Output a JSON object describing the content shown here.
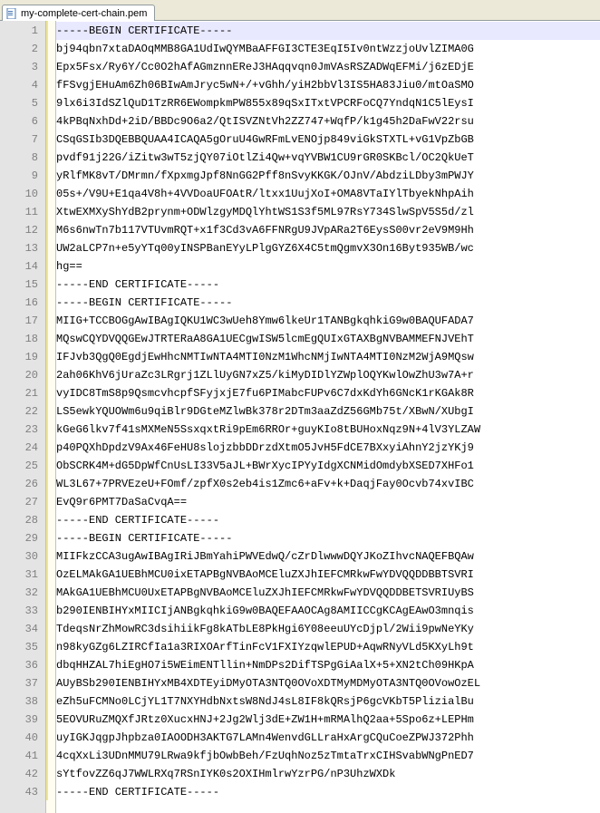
{
  "tab": {
    "filename": "my-complete-cert-chain.pem"
  },
  "lines": [
    "-----BEGIN CERTIFICATE-----",
    "bj94qbn7xtaDAOqMMB8GA1UdIwQYMBaAFFGI3CTE3EqI5Iv0ntWzzjoUvlZIMA0G",
    "Epx5Fsx/Ry6Y/Cc0O2hAfAGmznnEReJ3HAqqvqn0JmVAsRSZADWqEFMi/j6zEDjE",
    "fFSvgjEHuAm6Zh06BIwAmJryc5wN+/+vGhh/yiH2bbVl3IS5HA83Jiu0/mtOaSMO",
    "9lx6i3IdSZlQuD1TzRR6EWompkmPW855x89qSxITxtVPCRFoCQ7YndqN1C5lEysI",
    "4kPBqNxhDd+2iD/BBDc9O6a2/QtISVZNtVh2ZZ747+WqfP/k1g45h2DaFwV22rsu",
    "CSqGSIb3DQEBBQUAA4ICAQA5gOruU4GwRFmLvENOjp849viGkSTXTL+vG1VpZbGB",
    "pvdf91j22G/iZitw3wT5zjQY07iOtlZi4Qw+vqYVBW1CU9rGR0SKBcl/OC2QkUeT",
    "yRlfMK8vT/DMrmn/fXpxmgJpf8NnGG2Pff8nSvyKKGK/OJnV/AbdziLDby3mPWJY",
    "05s+/V9U+E1qa4V8h+4VVDoaUFOAtR/ltxx1UujXoI+OMA8VTaIYlTbyekNhpAih",
    "XtwEXMXyShYdB2prynm+ODWlzgyMDQlYhtWS1S3f5ML97RsY734SlwSpV5S5d/zl",
    "M6s6nwTn7b117VTUvmRQT+x1f3Cd3vA6FFNRgU9JVpARa2T6EysS00vr2eV9M9Hh",
    "UW2aLCP7n+e5yYTq00yINSPBanEYyLPlgGYZ6X4C5tmQgmvX3On16Byt935WB/wc",
    "hg==",
    "-----END CERTIFICATE-----",
    "-----BEGIN CERTIFICATE-----",
    "MIIG+TCCBOGgAwIBAgIQKU1WC3wUeh8Ymw6lkeUr1TANBgkqhkiG9w0BAQUFADA7",
    "MQswCQYDVQQGEwJTRTERaA8GA1UECgwISW5lcmEgQUIxGTAXBgNVBAMMEFNJVEhT",
    "IFJvb3QgQ0EgdjEwHhcNMTIwNTA4MTI0NzM1WhcNMjIwNTA4MTI0NzM2WjA9MQsw",
    "2ah06KhV6jUraZc3LRgrj1ZLlUyGN7xZ5/kiMyDIDlYZWplOQYKwlOwZhU3w7A+r",
    "vyIDC8TmS8p9QsmcvhcpfSFyjxjE7fu6PIMabcFUPv6C7dxKdYh6GNcK1rKGAk8R",
    "LS5ewkYQUOWm6u9qiBlr9DGteMZlwBk378r2DTm3aaZdZ56GMb75t/XBwN/XUbgI",
    "kGeG6lkv7f41sMXMeN5SsxqxtRi9pEm6RROr+guyKIo8tBUHoxNqz9N+4lV3YLZAW",
    "p40PQXhDpdzV9Ax46FeHU8slojzbbDDrzdXtmO5JvH5FdCE7BXxyiAhnY2jzYKj9",
    "ObSCRK4M+dG5DpWfCnUsLI33V5aJL+BWrXycIPYyIdgXCNMidOmdybXSED7XHFo1",
    "WL3L67+7PRVEzeU+FOmf/zpfX0s2eb4is1Zmc6+aFv+k+DaqjFay0Ocvb74xvIBC",
    "EvQ9r6PMT7DaSaCvqA==",
    "-----END CERTIFICATE-----",
    "-----BEGIN CERTIFICATE-----",
    "MIIFkzCCA3ugAwIBAgIRiJBmYahiPWVEdwQ/cZrDlwwwDQYJKoZIhvcNAQEFBQAw",
    "OzELMAkGA1UEBhMCU0ixETAPBgNVBAoMCEluZXJhIEFCMRkwFwYDVQQDDBBTSVRI",
    "MAkGA1UEBhMCU0UxETAPBgNVBAoMCEluZXJhIEFCMRkwFwYDVQQDDBETSVRIUyBS",
    "b290IENBIHYxMIICIjANBgkqhkiG9w0BAQEFAAOCAg8AMIICCgKCAgEAwO3mnqis",
    "TdeqsNrZhMowRC3dsihiikFg8kATbLE8PkHgi6Y08eeuUYcDjpl/2Wii9pwNeYKy",
    "n98kyGZg6LZIRCfIa1a3RIXOArfTinFcV1FXIYzqwlEPUD+AqwRNyVLd5KXyLh9t",
    "dbqHHZAL7hiEgHO7i5WEimENTllin+NmDPs2DifTSPgGiAalX+5+XN2tCh09HKpA",
    "AUyBSb290IENBIHYxMB4XDTEyiDMyOTA3NTQ0OVoXDTMyMDMyOTA3NTQ0OVowOzEL",
    "eZh5uFCMNo0LCjYL1T7NXYHdbNxtsW8NdJ4sL8IF8kQRsjP6gcVKbT5PlizialBu",
    "5EOVURuZMQXfJRtz0XucxHNJ+2Jg2Wlj3dE+ZW1H+mRMAlhQ2aa+5Spo6z+LEPHm",
    "uyIGKJqgpJhpbza0IAOODH3AKTG7LAMn4WenvdGLLraHxArgCQuCoeZPWJ372Phh",
    "4cqXxLi3UDnMMU79LRwa9kfjbOwbBeh/FzUqhNoz5zTmtaTrxCIHSvabWNgPnED7",
    "sYtfovZZ6qJ7WWLRXq7RSnIYK0s2OXIHmlrwYzrPG/nP3UhzWXDk",
    "-----END CERTIFICATE-----"
  ],
  "current_line_index": 0
}
